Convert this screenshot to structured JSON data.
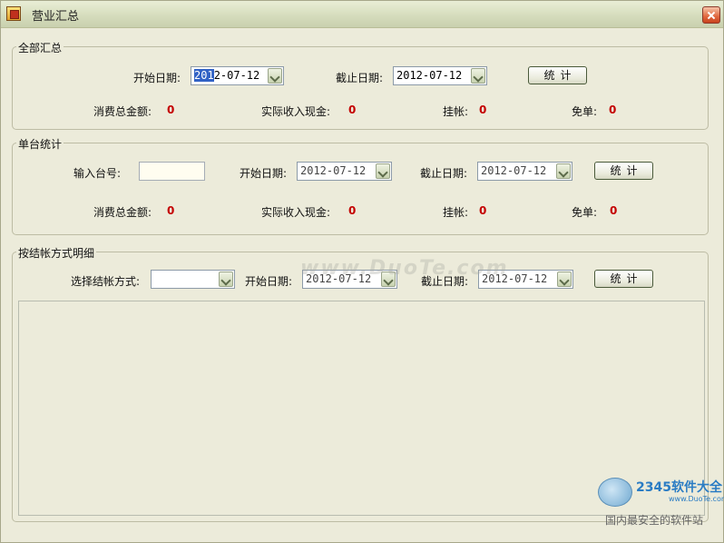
{
  "window": {
    "title": "营业汇总",
    "close_icon": "close-icon"
  },
  "summary": {
    "legend": "全部汇总",
    "start_label": "开始日期:",
    "start_date_selected": "201",
    "start_date_rest": "2-07-12",
    "end_label": "截止日期:",
    "end_date": "2012-07-12",
    "stat_button": "统计",
    "consume_label": "消费总金额:",
    "consume_value": "0",
    "cash_label": "实际收入现金:",
    "cash_value": "0",
    "credit_label": "挂帐:",
    "credit_value": "0",
    "free_label": "免单:",
    "free_value": "0"
  },
  "single": {
    "legend": "单台统计",
    "table_label": "输入台号:",
    "table_value": "",
    "start_label": "开始日期:",
    "start_date": "2012-07-12",
    "end_label": "截止日期:",
    "end_date": "2012-07-12",
    "stat_button": "统计",
    "consume_label": "消费总金额:",
    "consume_value": "0",
    "cash_label": "实际收入现金:",
    "cash_value": "0",
    "credit_label": "挂帐:",
    "credit_value": "0",
    "free_label": "免单:",
    "free_value": "0"
  },
  "settlement": {
    "legend": "按结帐方式明细",
    "method_label": "选择结帐方式:",
    "method_value": "",
    "start_label": "开始日期:",
    "start_date": "2012-07-12",
    "end_label": "截止日期:",
    "end_date": "2012-07-12",
    "stat_button": "统计"
  },
  "watermark": {
    "center_text": "www.DuoTe.com",
    "badge_title": "2345软件大全",
    "badge_url": "www.DuoTe.com",
    "tagline": "国内最安全的软件站"
  }
}
